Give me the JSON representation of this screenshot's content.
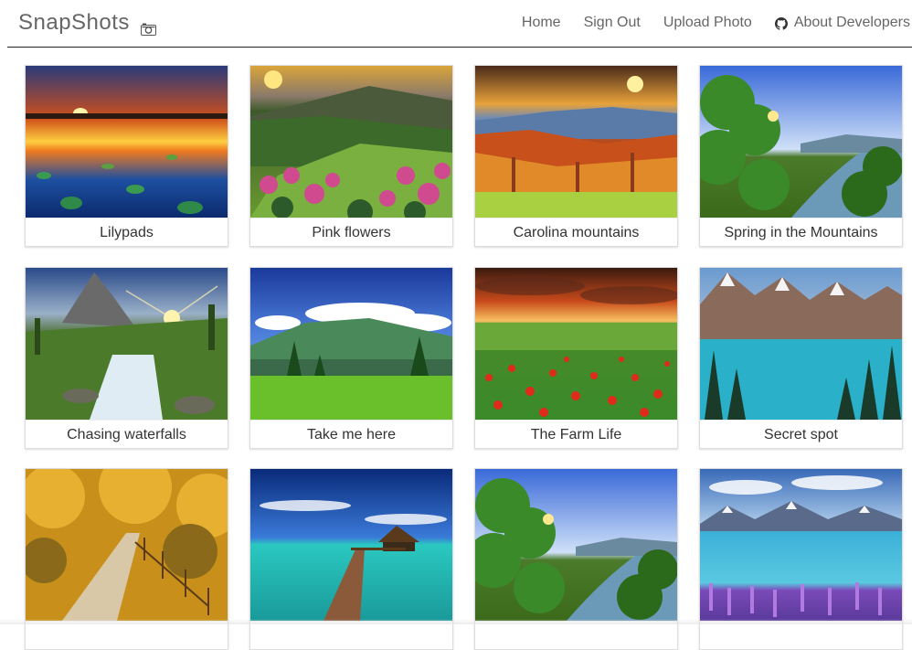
{
  "brand": {
    "title": "SnapShots",
    "icon": "camera-icon"
  },
  "nav": {
    "home": "Home",
    "sign_out": "Sign Out",
    "upload": "Upload Photo",
    "about": "About Developers",
    "about_icon": "github-icon"
  },
  "photos": [
    {
      "caption": "Lilypads",
      "scene": "sunset-lake"
    },
    {
      "caption": "Pink flowers",
      "scene": "pink-flowers-valley"
    },
    {
      "caption": "Carolina mountains",
      "scene": "autumn-mountains"
    },
    {
      "caption": "Spring in the Mountains",
      "scene": "spring-river"
    },
    {
      "caption": "Chasing waterfalls",
      "scene": "waterfall-sunburst"
    },
    {
      "caption": "Take me here",
      "scene": "green-hills"
    },
    {
      "caption": "The Farm Life",
      "scene": "poppy-field"
    },
    {
      "caption": "Secret spot",
      "scene": "mountain-lake"
    },
    {
      "caption": "",
      "scene": "autumn-path"
    },
    {
      "caption": "",
      "scene": "tropical-pier"
    },
    {
      "caption": "",
      "scene": "spring-river-2"
    },
    {
      "caption": "",
      "scene": "lupine-lake"
    }
  ]
}
